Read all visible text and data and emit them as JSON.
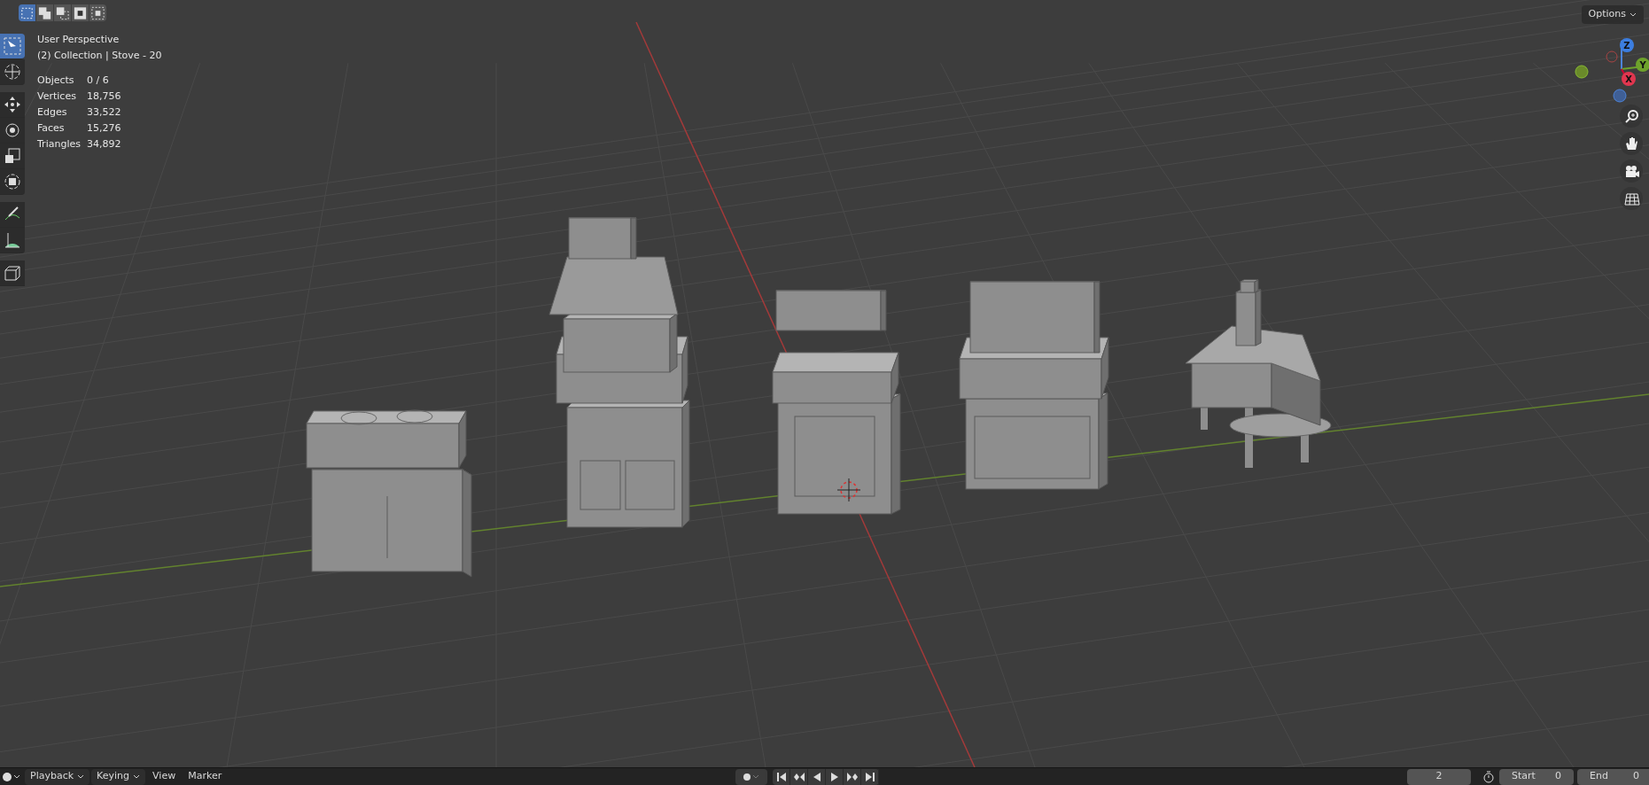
{
  "select_modes": [
    {
      "selected": true
    },
    {
      "selected": false
    },
    {
      "selected": false
    },
    {
      "selected": false
    },
    {
      "selected": false
    }
  ],
  "toolbar": {
    "tools": [
      {
        "selected": true
      },
      {
        "selected": false
      },
      {
        "selected": false
      },
      {
        "selected": false
      },
      {
        "selected": false
      },
      {
        "selected": false
      },
      {
        "selected": false
      },
      {
        "selected": false
      },
      {
        "selected": false
      }
    ]
  },
  "viewport": {
    "view_name": "User Perspective",
    "collection_line": "(2) Collection | Stove - 20",
    "stats": [
      {
        "label": "Objects",
        "value": "0 / 6"
      },
      {
        "label": "Vertices",
        "value": "18,756"
      },
      {
        "label": "Edges",
        "value": "33,522"
      },
      {
        "label": "Faces",
        "value": "15,276"
      },
      {
        "label": "Triangles",
        "value": "34,892"
      }
    ],
    "options_button": "Options",
    "gizmo": {
      "z": "Z",
      "y": "Y",
      "x": "X"
    }
  },
  "timeline": {
    "menus": [
      {
        "label": "Playback",
        "dropdown": true
      },
      {
        "label": "Keying",
        "dropdown": true
      },
      {
        "label": "View",
        "dropdown": false
      },
      {
        "label": "Marker",
        "dropdown": false
      }
    ],
    "current_frame": "2",
    "start_label": "Start",
    "start_value": "0",
    "end_label": "End",
    "end_value": "0"
  }
}
